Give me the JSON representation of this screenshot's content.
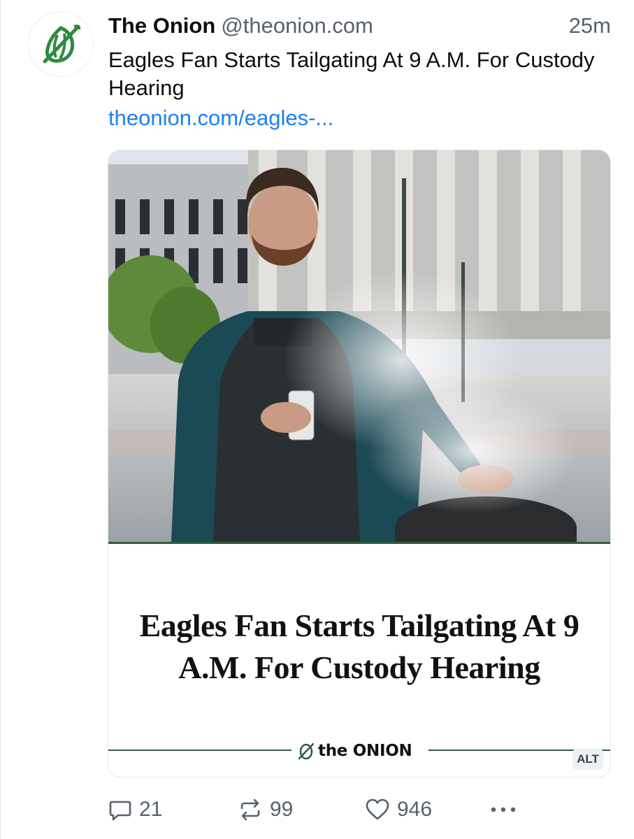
{
  "post": {
    "author_name": "The Onion",
    "author_handle": "@theonion.com",
    "time": "25m",
    "text": "Eagles Fan Starts Tailgating At 9 A.M. For Custody Hearing",
    "link": "theonion.com/eagles-..."
  },
  "card": {
    "headline": "Eagles Fan Starts Tailgating At 9 A.M. For Custody Hearing",
    "brand": "the ONION",
    "alt_label": "ALT"
  },
  "actions": {
    "replies": "21",
    "reposts": "99",
    "likes": "946"
  },
  "colors": {
    "link": "#1d7ff0",
    "brand_green": "#2e5e3e",
    "muted": "#56616c"
  },
  "icons": [
    "onion-logo-icon",
    "reply-icon",
    "repost-icon",
    "like-icon",
    "more-icon"
  ]
}
